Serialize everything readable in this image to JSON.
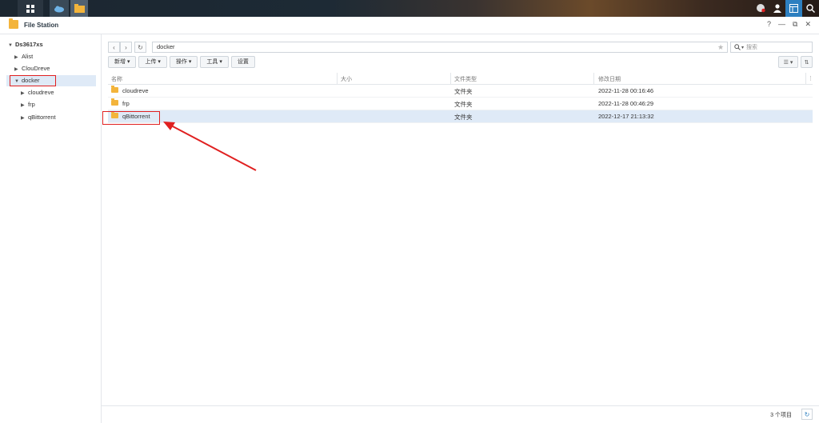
{
  "window": {
    "title": "File Station",
    "help": "?",
    "minimize": "—",
    "restore": "⧉",
    "close": "✕"
  },
  "taskbar": {
    "icons": [
      "main-menu-icon",
      "app-icon",
      "file-station-icon"
    ],
    "right_icons": [
      "chat-icon",
      "user-icon",
      "widgets-icon",
      "search-icon"
    ]
  },
  "sidebar": {
    "root": "Ds3617xs",
    "items": [
      {
        "label": "Alist"
      },
      {
        "label": "ClouDreve"
      },
      {
        "label": "docker"
      },
      {
        "label": "cloudreve"
      },
      {
        "label": "frp"
      },
      {
        "label": "qBittorrent"
      }
    ]
  },
  "path": {
    "value": "docker"
  },
  "search": {
    "placeholder": "搜索"
  },
  "toolbar": {
    "new": "新增 ▾",
    "upload": "上传 ▾",
    "action": "操作 ▾",
    "tools": "工具 ▾",
    "settings": "设置"
  },
  "columns": {
    "name": "名称",
    "size": "大小",
    "type": "文件类型",
    "modified": "修改日期"
  },
  "rows": [
    {
      "name": "cloudreve",
      "size": "",
      "type": "文件夹",
      "modified": "2022-11-28 00:16:46"
    },
    {
      "name": "frp",
      "size": "",
      "type": "文件夹",
      "modified": "2022-11-28 00:46:29"
    },
    {
      "name": "qBittorrent",
      "size": "",
      "type": "文件夹",
      "modified": "2022-12-17 21:13:32"
    }
  ],
  "status": {
    "count": "3 个项目"
  },
  "colors": {
    "accent": "#2d7fc0",
    "selection": "#dfeaf7",
    "annotation": "#e02020",
    "folder": "#f3b43b"
  }
}
